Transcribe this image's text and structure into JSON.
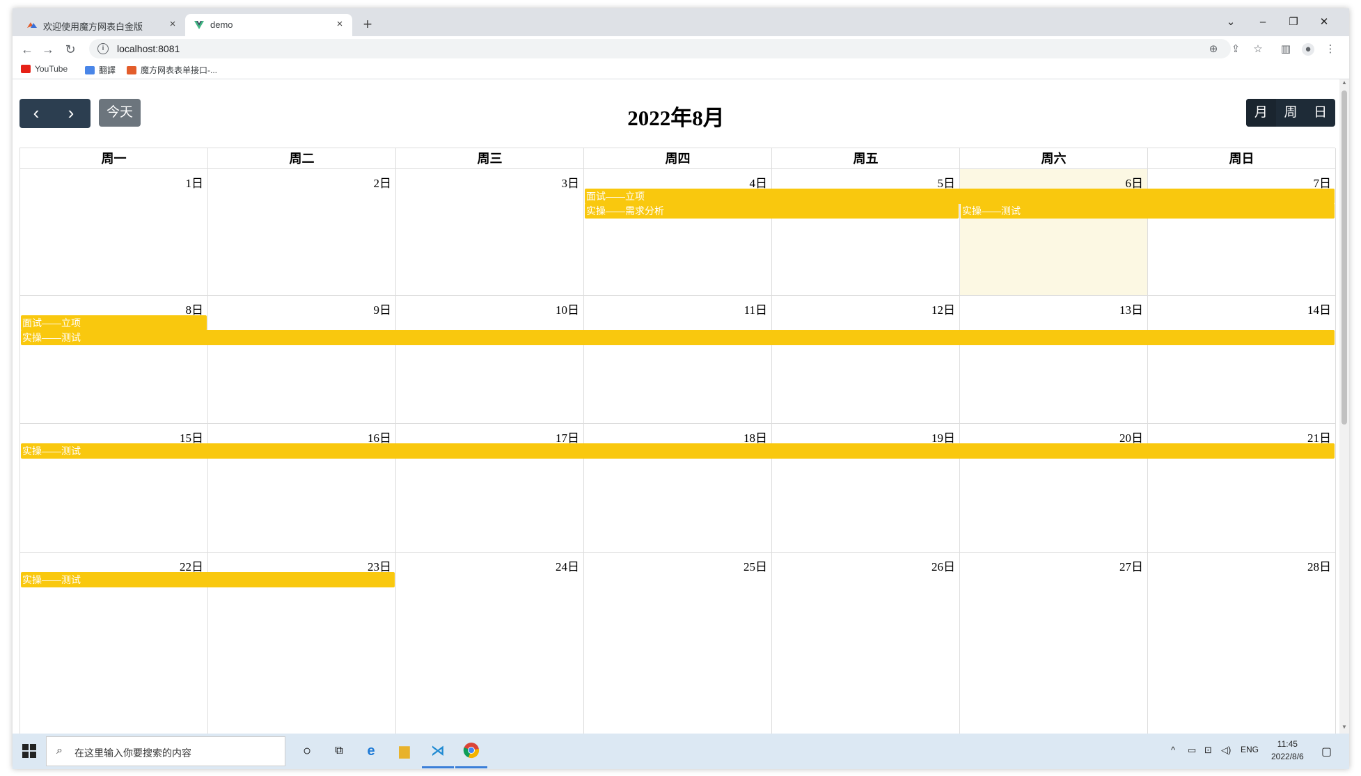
{
  "browser": {
    "tabs": [
      {
        "title": "欢迎使用魔方网表白金版",
        "close": "×"
      },
      {
        "title": "demo",
        "close": "×"
      }
    ],
    "new_tab": "+",
    "url": "localhost:8081",
    "bookmarks": [
      "YouTube",
      "翻譯",
      "魔方网表表单接口-..."
    ]
  },
  "calendar": {
    "title": "2022年8月",
    "prev_icon": "‹",
    "next_icon": "›",
    "today_label": "今天",
    "views": [
      "月",
      "周",
      "日"
    ],
    "active_view": "月",
    "weekdays": [
      "周一",
      "周二",
      "周三",
      "周四",
      "周五",
      "周六",
      "周日"
    ],
    "weeks": [
      [
        "1日",
        "2日",
        "3日",
        "4日",
        "5日",
        "6日",
        "7日"
      ],
      [
        "8日",
        "9日",
        "10日",
        "11日",
        "12日",
        "13日",
        "14日"
      ],
      [
        "15日",
        "16日",
        "17日",
        "18日",
        "19日",
        "20日",
        "21日"
      ],
      [
        "22日",
        "23日",
        "24日",
        "25日",
        "26日",
        "27日",
        "28日"
      ]
    ],
    "highlight_day": "6日",
    "event_color": "#f9c80e",
    "highlight_color": "#fcf8e3",
    "events": [
      {
        "week": 0,
        "start": 3,
        "span": 4,
        "row": 0,
        "title": "面试——立项"
      },
      {
        "week": 0,
        "start": 3,
        "span": 2,
        "row": 1,
        "title": "实操——需求分析"
      },
      {
        "week": 0,
        "start": 5,
        "span": 2,
        "row": 1,
        "title": "实操——测试"
      },
      {
        "week": 1,
        "start": 0,
        "span": 1,
        "row": 0,
        "title": "面试——立项"
      },
      {
        "week": 1,
        "start": 0,
        "span": 7,
        "row": 1,
        "title": "实操——测试"
      },
      {
        "week": 2,
        "start": 0,
        "span": 7,
        "row": 0,
        "title": "实操——测试"
      },
      {
        "week": 3,
        "start": 0,
        "span": 2,
        "row": 0,
        "title": "实操——测试"
      }
    ]
  },
  "taskbar": {
    "search_placeholder": "在这里输入你要搜索的内容",
    "lang": "ENG",
    "time": "11:45",
    "date": "2022/8/6"
  }
}
